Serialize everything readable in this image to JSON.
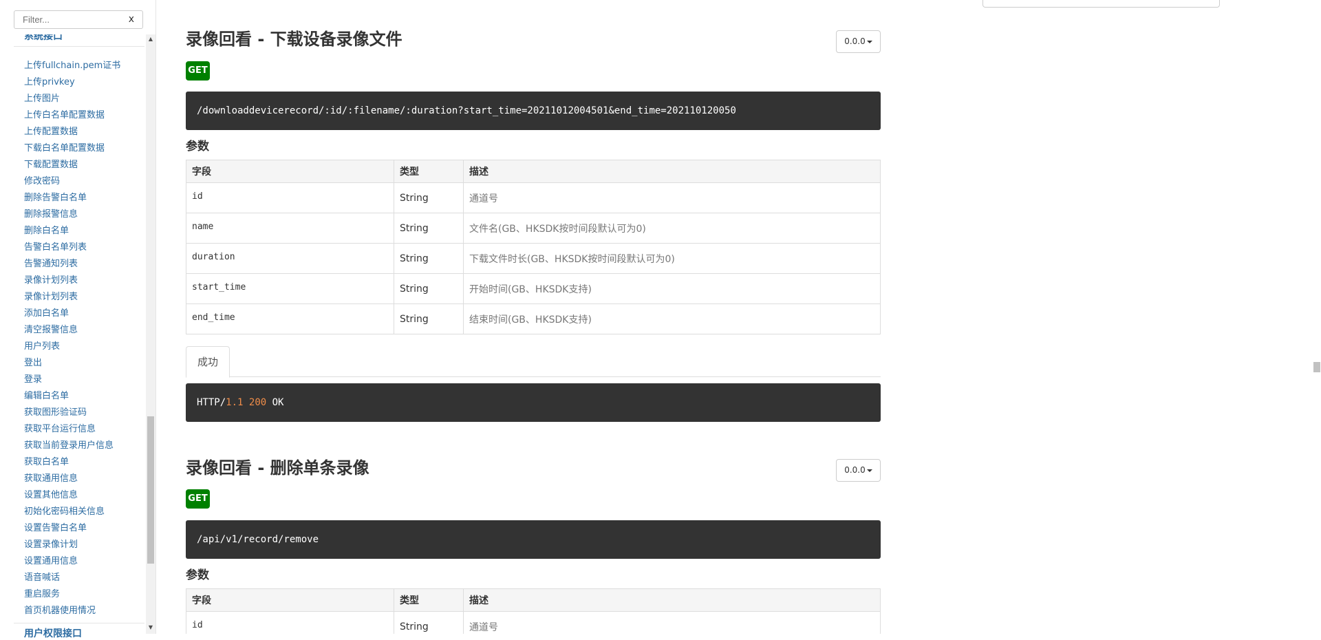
{
  "sidebar": {
    "filter_placeholder": "Filter...",
    "filter_clear": "x",
    "group_top": "系统接口",
    "items": [
      "上传fullchain.pem证书",
      "上传privkey",
      "上传图片",
      "上传白名单配置数据",
      "上传配置数据",
      "下载白名单配置数据",
      "下载配置数据",
      "修改密码",
      "删除告警白名单",
      "删除报警信息",
      "删除白名单",
      "告警白名单列表",
      "告警通知列表",
      "录像计划列表",
      "录像计划列表",
      "添加白名单",
      "清空报警信息",
      "用户列表",
      "登出",
      "登录",
      "编辑白名单",
      "获取图形验证码",
      "获取平台运行信息",
      "获取当前登录用户信息",
      "获取白名单",
      "获取通用信息",
      "设置其他信息",
      "初始化密码相关信息",
      "设置告警白名单",
      "设置录像计划",
      "设置通用信息",
      "语音喊话",
      "重启服务",
      "首页机器使用情况"
    ],
    "group_bottom": "用户权限接口"
  },
  "sections": [
    {
      "title": "录像回看 - 下载设备录像文件",
      "version": "0.0.0",
      "method": "GET",
      "url": "/downloaddevicerecord/:id/:filename/:duration?start_time=20211012004501&end_time=202110120050",
      "params_heading": "参数",
      "columns": [
        "字段",
        "类型",
        "描述"
      ],
      "params": [
        {
          "field": "id",
          "type": "String",
          "desc": "通道号"
        },
        {
          "field": "name",
          "type": "String",
          "desc": "文件名(GB、HKSDK按时间段默认可为0)"
        },
        {
          "field": "duration",
          "type": "String",
          "desc": "下载文件时长(GB、HKSDK按时间段默认可为0)"
        },
        {
          "field": "start_time",
          "type": "String",
          "desc": "开始时间(GB、HKSDK支持)"
        },
        {
          "field": "end_time",
          "type": "String",
          "desc": "结束时间(GB、HKSDK支持)"
        }
      ],
      "success_tab": "成功",
      "response": {
        "proto": "HTTP/",
        "version": "1.1",
        "code": "200",
        "status": "OK"
      }
    },
    {
      "title": "录像回看 - 删除单条录像",
      "version": "0.0.0",
      "method": "GET",
      "url": "/api/v1/record/remove",
      "params_heading": "参数",
      "columns": [
        "字段",
        "类型",
        "描述"
      ],
      "params": [
        {
          "field": "id",
          "type": "String",
          "desc": "通道号"
        }
      ]
    }
  ],
  "colors": {
    "link": "#2d6ca2",
    "get_badge": "#008000",
    "code_bg": "#333333",
    "number": "#f08d49"
  }
}
